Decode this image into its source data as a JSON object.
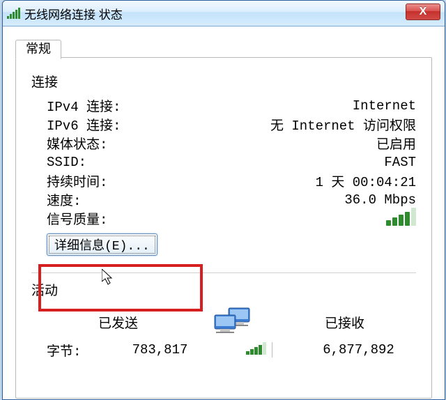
{
  "window": {
    "title": "无线网络连接 状态",
    "close_label": "X"
  },
  "tab": {
    "label": "常规"
  },
  "connection": {
    "section": "连接",
    "ipv4_label": "IPv4 连接:",
    "ipv4_value": "Internet",
    "ipv6_label": "IPv6 连接:",
    "ipv6_value": "无 Internet 访问权限",
    "media_label": "媒体状态:",
    "media_value": "已启用",
    "ssid_label": "SSID:",
    "ssid_value": "FAST",
    "duration_label": "持续时间:",
    "duration_value": "1 天 00:04:21",
    "speed_label": "速度:",
    "speed_value": "36.0 Mbps",
    "signal_label": "信号质量:"
  },
  "details_button": "详细信息(E)...",
  "activity": {
    "section": "活动",
    "sent_label": "已发送",
    "received_label": "已接收",
    "bytes_label": "字节:",
    "sent_value": "783,817",
    "received_value": "6,877,892"
  }
}
